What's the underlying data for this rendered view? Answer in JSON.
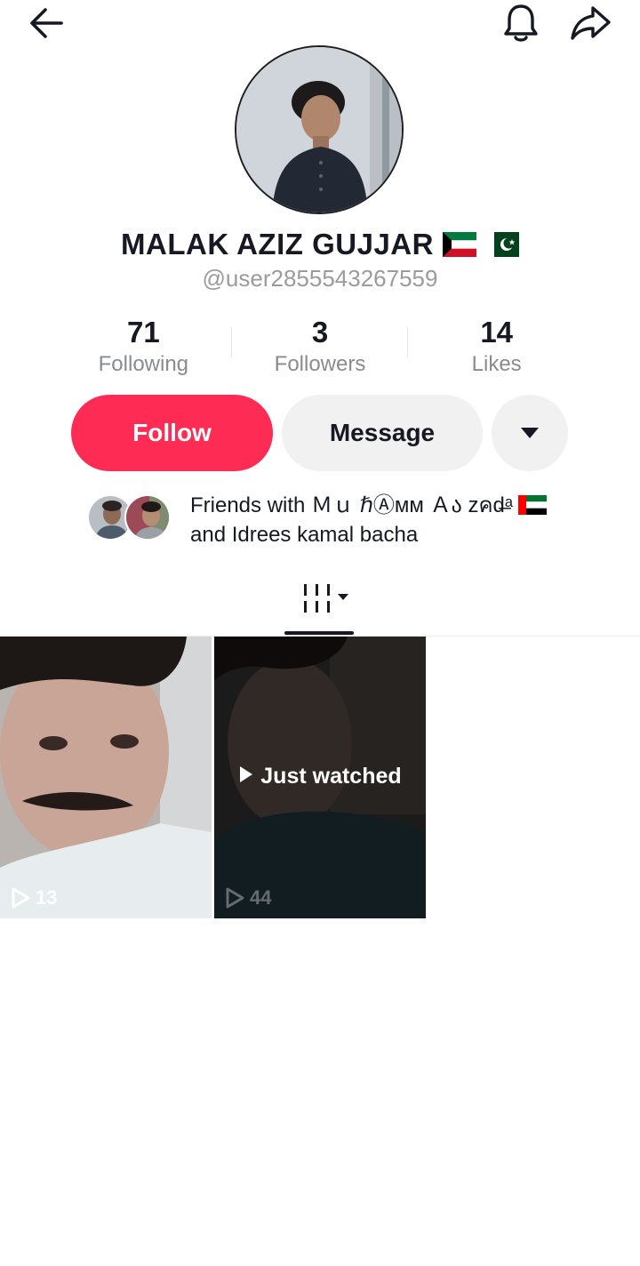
{
  "header": {
    "back_icon": "arrow-left-icon",
    "bell_icon": "bell-icon",
    "share_icon": "share-arrow-icon"
  },
  "profile": {
    "display_name": "MALAK AZIZ GUJJAR",
    "flags": [
      "kuwait-flag",
      "pakistan-flag"
    ],
    "username": "@user2855543267559"
  },
  "stats": [
    {
      "value": "71",
      "label": "Following"
    },
    {
      "value": "3",
      "label": "Followers"
    },
    {
      "value": "14",
      "label": "Likes"
    }
  ],
  "actions": {
    "follow_label": "Follow",
    "message_label": "Message",
    "more_icon": "caret-down-icon",
    "follow_color": "#fe2c55"
  },
  "friends": {
    "line1": "Friends with Ｍｕ ℏⒶᴍᴍ Ａა ᴢคd̶ᵃ",
    "line1_flag": "uae-flag",
    "line2": " and Idrees kamal bacha"
  },
  "tabs": {
    "active_icon": "grid-columns-icon"
  },
  "videos": [
    {
      "views": "13",
      "overlay": ""
    },
    {
      "views": "44",
      "overlay": "Just watched"
    }
  ]
}
